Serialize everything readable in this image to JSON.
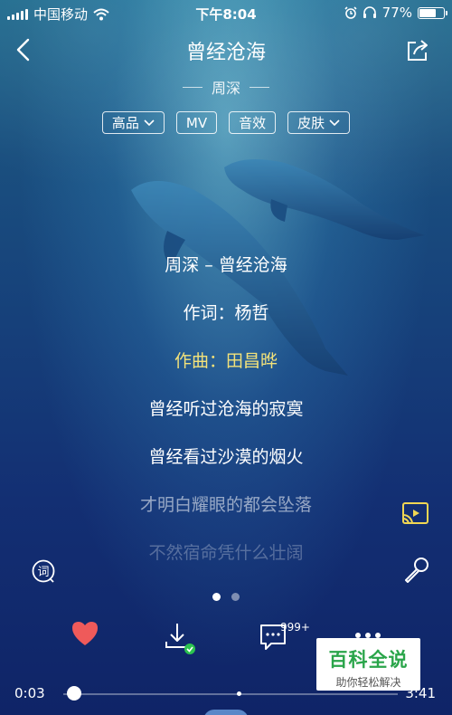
{
  "status_bar": {
    "carrier": "中国移动",
    "time": "下午8:04",
    "battery_text": "77%",
    "battery_level": 0.77
  },
  "header": {
    "title": "曾经沧海",
    "artist": "周深"
  },
  "tags": [
    "高品",
    "MV",
    "音效",
    "皮肤"
  ],
  "lyrics": [
    "周深 – 曾经沧海",
    "作词：杨哲",
    "作曲：田昌晔",
    "曾经听过沧海的寂寞",
    "曾经看过沙漠的烟火",
    "才明白耀眼的都会坠落",
    "不然宿命凭什么壮阔"
  ],
  "lyrics_active_index": 2,
  "lyric_button_label": "词",
  "page_dots": {
    "total": 2,
    "active": 0
  },
  "actions": {
    "comment_count": "999+"
  },
  "progress": {
    "current": "0:03",
    "total": "3:41",
    "fraction": 0.014
  },
  "watermark": {
    "title": "百科全说",
    "subtitle": "助你轻松解决"
  },
  "colors": {
    "heart": "#ef5a5a",
    "active_lyric": "#f3e27a",
    "download_check": "#2cc34f",
    "watermark_green": "#2aa54a"
  }
}
